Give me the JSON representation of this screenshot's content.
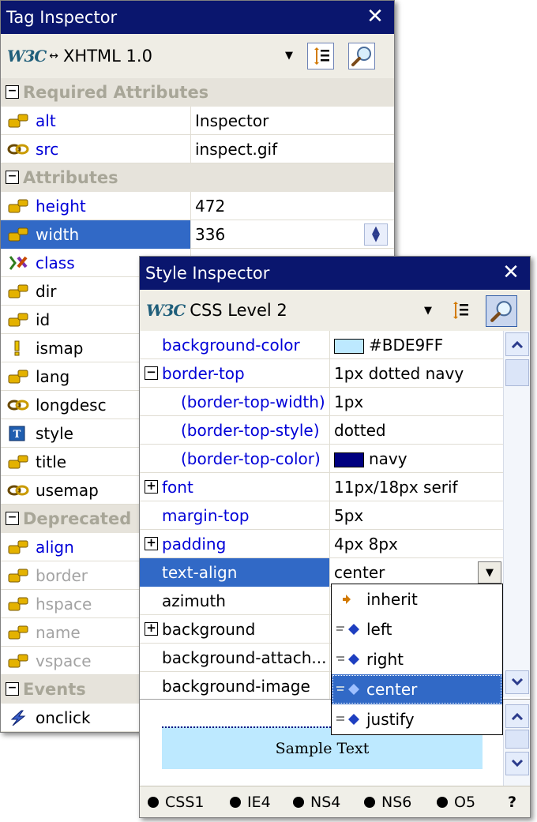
{
  "tag_inspector": {
    "title": "Tag Inspector",
    "doctype": "XHTML 1.0",
    "groups": {
      "required": "Required Attributes",
      "attributes": "Attributes",
      "deprecated": "Deprecated",
      "events": "Events"
    },
    "required_rows": [
      {
        "name": "alt",
        "value": "Inspector"
      },
      {
        "name": "src",
        "value": "inspect.gif"
      }
    ],
    "attribute_rows": [
      {
        "name": "height",
        "value": "472"
      },
      {
        "name": "width",
        "value": "336"
      },
      {
        "name": "class",
        "value": ""
      },
      {
        "name": "dir",
        "value": ""
      },
      {
        "name": "id",
        "value": ""
      },
      {
        "name": "ismap",
        "value": ""
      },
      {
        "name": "lang",
        "value": ""
      },
      {
        "name": "longdesc",
        "value": ""
      },
      {
        "name": "style",
        "value": ""
      },
      {
        "name": "title",
        "value": ""
      },
      {
        "name": "usemap",
        "value": ""
      }
    ],
    "deprecated_rows": [
      {
        "name": "align",
        "value": ""
      },
      {
        "name": "border",
        "value": ""
      },
      {
        "name": "hspace",
        "value": ""
      },
      {
        "name": "name",
        "value": ""
      },
      {
        "name": "vspace",
        "value": ""
      }
    ],
    "event_rows": [
      {
        "name": "onclick",
        "value": ""
      }
    ]
  },
  "style_inspector": {
    "title": "Style Inspector",
    "level": "CSS Level 2",
    "rows": [
      {
        "name": "background-color",
        "value": "#BDE9FF"
      },
      {
        "name": "border-top",
        "value": "1px dotted navy"
      },
      {
        "name": "(border-top-width)",
        "value": "1px"
      },
      {
        "name": "(border-top-style)",
        "value": "dotted"
      },
      {
        "name": "(border-top-color)",
        "value": "navy"
      },
      {
        "name": "font",
        "value": "11px/18px serif"
      },
      {
        "name": "margin-top",
        "value": "5px"
      },
      {
        "name": "padding",
        "value": "4px 8px"
      },
      {
        "name": "text-align",
        "value": "center"
      },
      {
        "name": "azimuth",
        "value": ""
      },
      {
        "name": "background",
        "value": ""
      },
      {
        "name": "background-attach...",
        "value": ""
      },
      {
        "name": "background-image",
        "value": ""
      }
    ],
    "dropdown_options": [
      "inherit",
      "left",
      "right",
      "center",
      "justify"
    ],
    "preview_text": "Sample Text",
    "compat": [
      "CSS1",
      "IE4",
      "NS4",
      "NS6",
      "O5"
    ],
    "help": "?"
  },
  "colors": {
    "titlebar": "#0a166e",
    "selection": "#3169c6",
    "attribute_name": "#0000d8",
    "swatch_bg": "#BDE9FF",
    "swatch_navy": "#000080"
  },
  "icons": {
    "close": "close-icon",
    "w3c": "w3c-logo",
    "sort": "sort-list-icon",
    "inspect": "magnifier-icon",
    "key": "key-icon",
    "link": "link-icon",
    "class": "class-icon",
    "alert": "exclamation-icon",
    "style": "style-icon",
    "event": "lightning-icon"
  }
}
